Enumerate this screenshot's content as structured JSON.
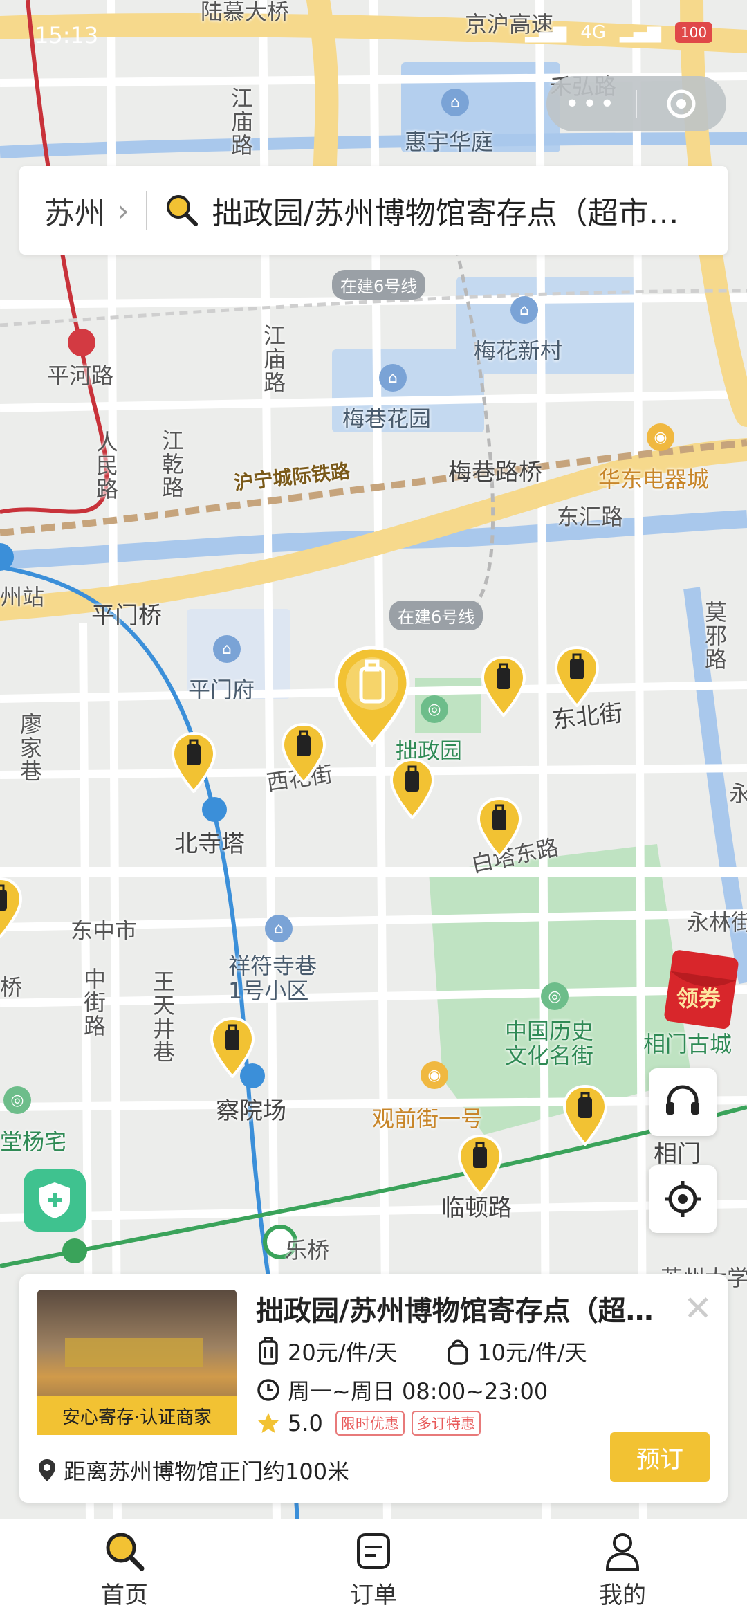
{
  "status_bar": {
    "time": "15:13",
    "network": "4G",
    "battery": "100"
  },
  "capsule": {
    "more": "•••"
  },
  "search": {
    "city": "苏州",
    "query": "拙政园/苏州博物馆寄存点（超市…"
  },
  "map": {
    "labels": {
      "lumu": "陆慕大桥",
      "jinghu": "京沪高速",
      "hehong": "禾弘路",
      "huiyu": "惠宇华庭",
      "jiangmiao1": "江庙路",
      "jiangmiao2": "江庙路",
      "line6_a": "在建6号线",
      "line6_b": "在建6号线",
      "meihua": "梅花新村",
      "pinghe": "平河路",
      "meixiang": "梅巷花园",
      "renmin": "人民路",
      "jianggan": "江乾路",
      "huning": "沪宁城际铁路",
      "meixiangbridge": "梅巷路桥",
      "huadong": "华东电器城",
      "donghui": "东汇路",
      "zhanzhan": "州站",
      "pingmen_bridge": "平门桥",
      "moxie": "莫邪路",
      "pingmenfu": "平门府",
      "zhuozheng": "拙政园",
      "dongbei": "东北街",
      "liaojia": "廖家巷",
      "xihua": "西花街",
      "beisita": "北寺塔",
      "baita": "白塔东路",
      "yong": "永",
      "yonglin": "永林街",
      "dongzhongshi": "东中市",
      "xiangfu": "祥符寺巷\n1号小区",
      "zhongjie": "中街路",
      "wangtian": "王天井巷",
      "zhongguo": "中国历史\n文化名街",
      "xiangmen_old": "相门古城",
      "yangzhai": "堂杨宅",
      "chayuan": "察院场",
      "guanqian": "观前街一号",
      "xiangmen": "相门",
      "linton": "临顿路",
      "qiao": "桥",
      "leqiao": "乐桥",
      "suda": "苏州大学"
    }
  },
  "coupon": {
    "label": "领券"
  },
  "card": {
    "title": "拙政园/苏州博物馆寄存点（超市…",
    "photo_badge": "安心寄存·认证商家",
    "price_large": "20元/件/天",
    "price_small": "10元/件/天",
    "hours": "周一~周日 08:00~23:00",
    "rating": "5.0",
    "tags": [
      "限时优惠",
      "多订特惠"
    ],
    "distance": "距离苏州博物馆正门约100米",
    "book": "预订"
  },
  "tabs": [
    {
      "label": "首页",
      "icon": "search-icon"
    },
    {
      "label": "订单",
      "icon": "order-icon"
    },
    {
      "label": "我的",
      "icon": "user-icon"
    }
  ],
  "colors": {
    "accent": "#f2c233",
    "road_major": "#f5d88a",
    "water": "#aac8ec",
    "park": "#bfe3c2"
  }
}
